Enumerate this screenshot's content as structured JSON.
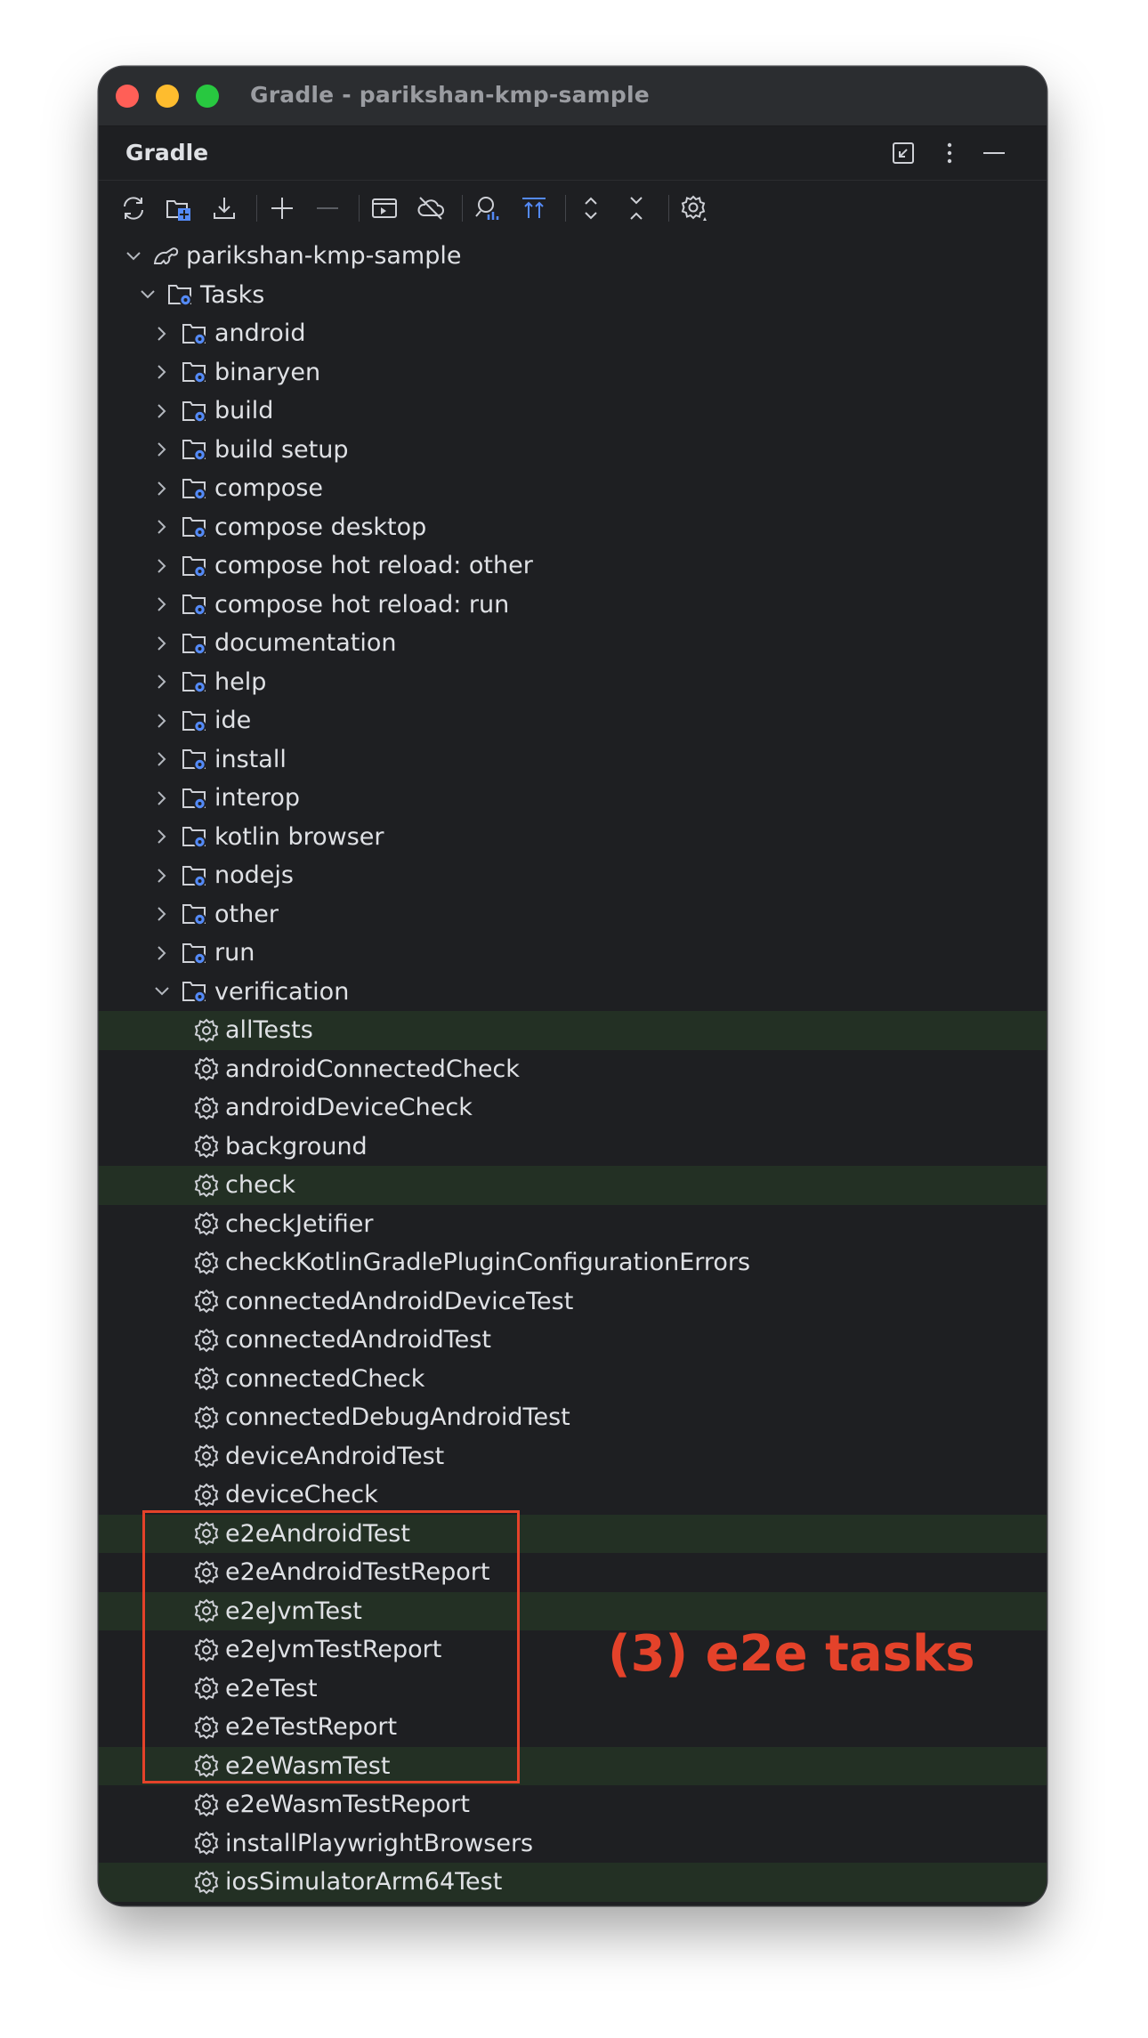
{
  "window": {
    "title": "Gradle - parikshan-kmp-sample"
  },
  "panel": {
    "title": "Gradle"
  },
  "toolbar": {
    "icons": [
      "refresh-icon",
      "link-project-icon",
      "download-sources-icon",
      "add-icon",
      "remove-icon",
      "run-task-icon",
      "offline-mode-icon",
      "analyze-dependencies-icon",
      "show-tasks-icon",
      "expand-all-icon",
      "collapse-all-icon",
      "settings-icon"
    ]
  },
  "tree": {
    "project": "parikshan-kmp-sample",
    "tasks_label": "Tasks",
    "groups": [
      "android",
      "binaryen",
      "build",
      "build setup",
      "compose",
      "compose desktop",
      "compose hot reload: other",
      "compose hot reload: run",
      "documentation",
      "help",
      "ide",
      "install",
      "interop",
      "kotlin browser",
      "nodejs",
      "other",
      "run",
      "verification"
    ],
    "verification_tasks": [
      "allTests",
      "androidConnectedCheck",
      "androidDeviceCheck",
      "background",
      "check",
      "checkJetifier",
      "checkKotlinGradlePluginConfigurationErrors",
      "connectedAndroidDeviceTest",
      "connectedAndroidTest",
      "connectedCheck",
      "connectedDebugAndroidTest",
      "deviceAndroidTest",
      "deviceCheck",
      "e2eAndroidTest",
      "e2eAndroidTestReport",
      "e2eJvmTest",
      "e2eJvmTestReport",
      "e2eTest",
      "e2eTestReport",
      "e2eWasmTest",
      "e2eWasmTestReport",
      "installPlaywrightBrowsers",
      "iosSimulatorArm64Test"
    ],
    "highlighted_tasks": [
      "allTests",
      "check",
      "e2eAndroidTest",
      "e2eJvmTest",
      "e2eWasmTest",
      "iosSimulatorArm64Test"
    ]
  },
  "annotation": {
    "text": "(3) e2e tasks",
    "color": "#e4422a"
  },
  "colors": {
    "background": "#1e1f22",
    "highlight_row": "#233024",
    "text": "#dfe1e5",
    "icon_blue": "#548af7"
  }
}
